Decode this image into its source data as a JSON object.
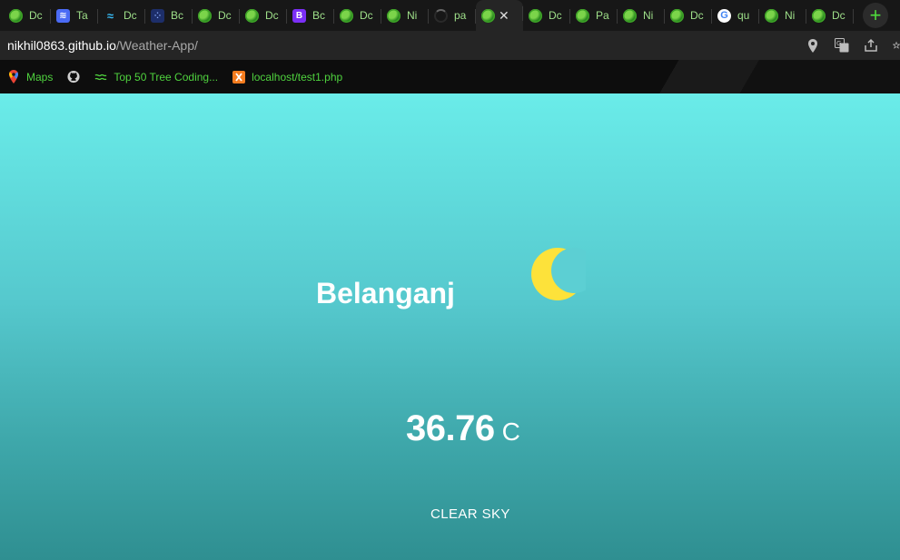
{
  "browser": {
    "tabs": [
      {
        "icon": "globe-icon",
        "label": "Dc"
      },
      {
        "icon": "tailwind-stack-icon",
        "label": "Ta"
      },
      {
        "icon": "tailwind-icon",
        "label": "Dc"
      },
      {
        "icon": "dots-icon",
        "label": "Bc"
      },
      {
        "icon": "globe-icon",
        "label": "Dc"
      },
      {
        "icon": "globe-icon",
        "label": "Dc"
      },
      {
        "icon": "bootstrap-icon",
        "label": "Bc"
      },
      {
        "icon": "globe-icon",
        "label": "Dc"
      },
      {
        "icon": "globe-icon",
        "label": "Ni"
      },
      {
        "icon": "loading-icon",
        "label": "pa"
      },
      {
        "icon": "globe-icon",
        "label": "",
        "active": true
      },
      {
        "icon": "globe-icon",
        "label": "Dc"
      },
      {
        "icon": "globe-icon",
        "label": "Pa"
      },
      {
        "icon": "globe-icon",
        "label": "Ni"
      },
      {
        "icon": "globe-icon",
        "label": "Dc"
      },
      {
        "icon": "google-icon",
        "label": "qu"
      },
      {
        "icon": "globe-icon",
        "label": "Ni"
      },
      {
        "icon": "globe-icon",
        "label": "Dc"
      }
    ],
    "address": {
      "host": "nikhil0863.github.io",
      "path": "/Weather-App/"
    },
    "bookmarks": [
      {
        "icon": "maps-icon",
        "label": "Maps"
      },
      {
        "icon": "github-icon",
        "label": ""
      },
      {
        "icon": "tree-icon",
        "label": "Top 50 Tree Coding..."
      },
      {
        "icon": "xampp-icon",
        "label": "localhost/test1.php"
      }
    ]
  },
  "weather": {
    "city": "Belanganj",
    "temperature": "36.76",
    "unit": "C",
    "description": "CLEAR SKY",
    "icon": "moon-icon"
  }
}
